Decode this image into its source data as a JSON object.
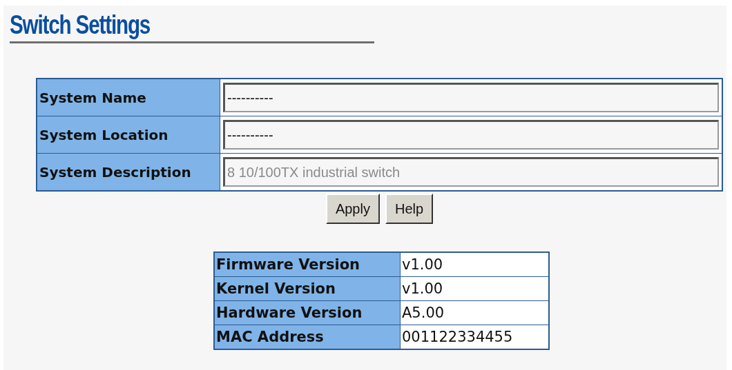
{
  "title": "Switch Settings",
  "settings": [
    {
      "label": "System Name",
      "value": "----------",
      "disabled": false
    },
    {
      "label": "System Location",
      "value": "----------",
      "disabled": false
    },
    {
      "label": "System Description",
      "value": "8 10/100TX industrial switch",
      "disabled": true
    }
  ],
  "buttons": [
    "Apply",
    "Help"
  ],
  "info": [
    {
      "label": "Firmware Version",
      "value": "v1.00"
    },
    {
      "label": "Kernel Version",
      "value": "v1.00"
    },
    {
      "label": "Hardware Version",
      "value": "A5.00"
    },
    {
      "label": "MAC Address",
      "value": "001122334455"
    }
  ]
}
